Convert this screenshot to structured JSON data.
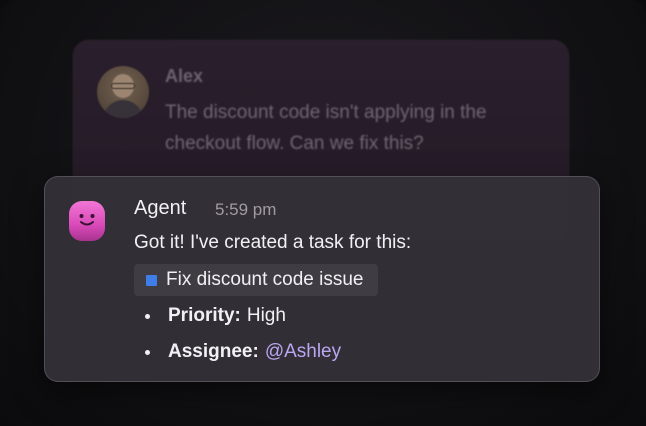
{
  "background_message": {
    "author": "Alex",
    "text": "The discount code isn't applying in the checkout flow. Can we fix this?"
  },
  "agent_message": {
    "author": "Agent",
    "time": "5:59 pm",
    "text": "Got it! I've created a task for this:",
    "task": {
      "label": "Fix discount code issue",
      "color": "#3f7ee8"
    },
    "details": [
      {
        "key": "Priority:",
        "value": "High"
      },
      {
        "key": "Assignee:",
        "value": "@Ashley"
      }
    ]
  },
  "colors": {
    "accent_mention": "#b8a8f2",
    "agent_avatar": "#d94ab8",
    "card_bg": "#343138"
  }
}
